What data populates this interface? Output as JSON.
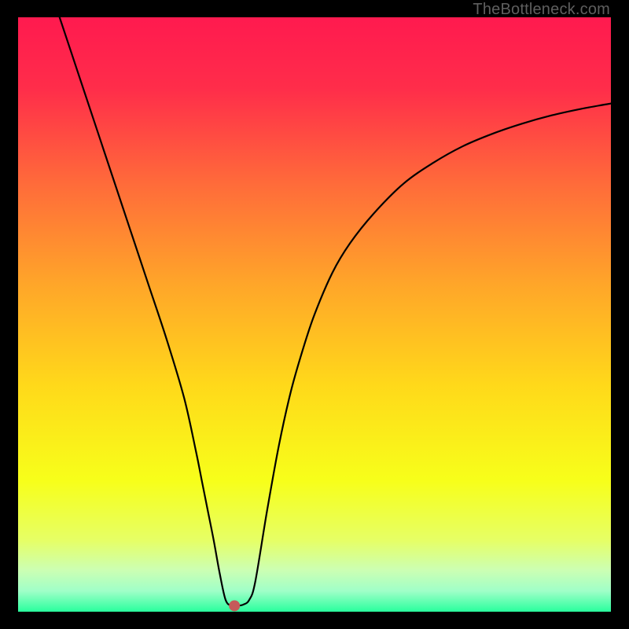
{
  "watermark": "TheBottleneck.com",
  "chart_data": {
    "type": "line",
    "title": "",
    "xlabel": "",
    "ylabel": "",
    "xlim": [
      0,
      100
    ],
    "ylim": [
      0,
      100
    ],
    "grid": false,
    "legend": false,
    "gradient_stops": [
      {
        "offset": 0.0,
        "color": "#ff1a4f"
      },
      {
        "offset": 0.12,
        "color": "#ff2d4a"
      },
      {
        "offset": 0.28,
        "color": "#ff6b3a"
      },
      {
        "offset": 0.45,
        "color": "#ffa629"
      },
      {
        "offset": 0.62,
        "color": "#ffd91a"
      },
      {
        "offset": 0.78,
        "color": "#f7ff1a"
      },
      {
        "offset": 0.88,
        "color": "#e6ff66"
      },
      {
        "offset": 0.93,
        "color": "#ccffb3"
      },
      {
        "offset": 0.965,
        "color": "#a0ffc8"
      },
      {
        "offset": 1.0,
        "color": "#29ff9d"
      }
    ],
    "series": [
      {
        "name": "curve",
        "x": [
          7,
          10,
          13,
          16,
          19,
          22,
          25,
          28,
          30,
          31,
          32,
          33,
          34,
          35,
          36,
          37,
          38,
          39,
          40,
          42,
          44,
          46,
          48,
          50,
          53,
          56,
          60,
          65,
          70,
          75,
          80,
          85,
          90,
          95,
          100
        ],
        "y": [
          100,
          91,
          82,
          73,
          64,
          55,
          46,
          36,
          27,
          22,
          17,
          12,
          6.5,
          2.0,
          1.0,
          1.0,
          1.2,
          2.0,
          5,
          17,
          28,
          37,
          44,
          50,
          57,
          62,
          67,
          72,
          75.5,
          78.3,
          80.4,
          82.1,
          83.5,
          84.6,
          85.5
        ]
      }
    ],
    "marker": {
      "x": 36.5,
      "y": 1.0,
      "color": "#c55a5a",
      "radius_px": 7
    }
  }
}
